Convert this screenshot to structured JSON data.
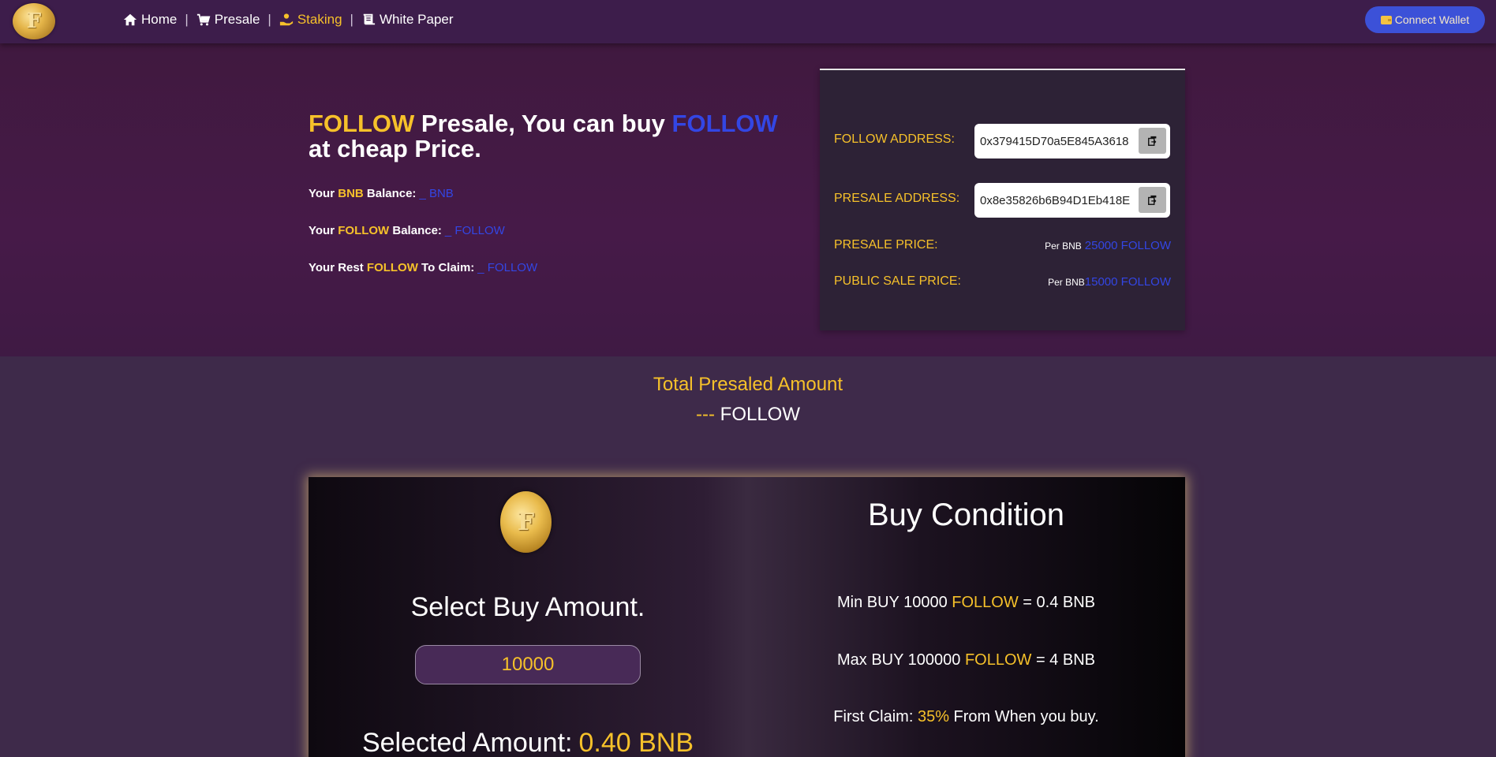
{
  "nav": {
    "logo_letter": "F",
    "items": [
      {
        "label": "Home",
        "icon": "home-icon"
      },
      {
        "label": "Presale",
        "icon": "cart-icon"
      },
      {
        "label": "Staking",
        "icon": "staking-hand-icon"
      },
      {
        "label": "White Paper",
        "icon": "scroll-icon"
      }
    ],
    "active": "Staking",
    "connect_label": "Connect Wallet"
  },
  "hero": {
    "title_part1": "FOLLOW",
    "title_part2": " Presale, You can buy ",
    "title_part3": "FOLLOW",
    "title_part4": "at cheap Price.",
    "bnb_balance": {
      "prefix": "Your ",
      "token": "BNB",
      "suffix": " Balance:",
      "value": "_ BNB"
    },
    "follow_balance": {
      "prefix": "Your ",
      "token": "FOLLOW",
      "suffix": " Balance:",
      "value": "_ FOLLOW"
    },
    "rest_claim": {
      "prefix": "Your Rest ",
      "token": "FOLLOW",
      "suffix": " To Claim:",
      "value": "_ FOLLOW"
    }
  },
  "info": {
    "follow_address_label": "FOLLOW ADDRESS:",
    "follow_address": "0x379415D70a5E845A3618",
    "presale_address_label": "PRESALE ADDRESS:",
    "presale_address": "0x8e35826b6B94D1Eb418E",
    "presale_price_label": "PRESALE PRICE:",
    "presale_price_per": "Per BNB",
    "presale_price_value": "25000 FOLLOW",
    "public_price_label": "PUBLIC SALE PRICE:",
    "public_price_per": "Per BNB",
    "public_price_value": "15000 FOLLOW"
  },
  "total": {
    "title": "Total Presaled Amount",
    "value_dashes": "---",
    "value_token": "FOLLOW"
  },
  "buy": {
    "coin_letter": "F",
    "select_title": "Select Buy Amount.",
    "amount_value": "10000",
    "selected_label": "Selected Amount:",
    "selected_value": "0.40 BNB",
    "condition_title": "Buy Condition",
    "min_pre": "Min BUY 10000 ",
    "min_token": "FOLLOW",
    "min_post": " = 0.4 BNB",
    "max_pre": "Max BUY 100000 ",
    "max_token": "FOLLOW",
    "max_post": " = 4 BNB",
    "claim_pre": "First Claim: ",
    "claim_pct": "35%",
    "claim_post": " From When you buy."
  },
  "colors": {
    "accent_yellow": "#f6c12a",
    "accent_blue": "#3346e4",
    "nav_bg": "#3d1d4b",
    "connect_bg": "#3c51d8"
  }
}
